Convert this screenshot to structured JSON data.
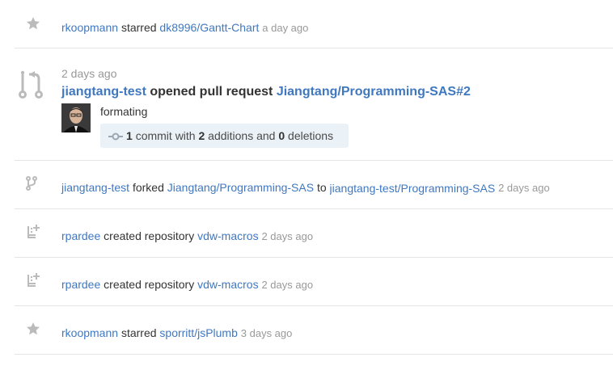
{
  "feed": {
    "item1": {
      "actor": "rkoopmann",
      "action": "starred",
      "target": "dk8996/Gantt-Chart",
      "time": "a day ago",
      "icon": "star-icon"
    },
    "item2": {
      "time": "2 days ago",
      "actor": "jiangtang-test",
      "action": "opened pull request",
      "target": "Jiangtang/Programming-SAS#2",
      "message": "formating",
      "commit_count": "1",
      "commit_word": "commit with",
      "additions": "2",
      "additions_word": "additions and",
      "deletions": "0",
      "deletions_word": "deletions",
      "icon": "git-pull-request-icon"
    },
    "item3": {
      "actor": "jiangtang-test",
      "action": "forked",
      "source": "Jiangtang/Programming-SAS",
      "to_word": "to",
      "target": "jiangtang-test/Programming-SAS",
      "time": "2 days ago",
      "icon": "repo-forked-icon"
    },
    "item4": {
      "actor": "rpardee",
      "action": "created repository",
      "target": "vdw-macros",
      "time": "2 days ago",
      "icon": "repo-create-icon"
    },
    "item5": {
      "actor": "rpardee",
      "action": "created repository",
      "target": "vdw-macros",
      "time": "2 days ago",
      "icon": "repo-create-icon"
    },
    "item6": {
      "actor": "rkoopmann",
      "action": "starred",
      "target": "sporritt/jsPlumb",
      "time": "3 days ago",
      "icon": "star-icon"
    }
  }
}
